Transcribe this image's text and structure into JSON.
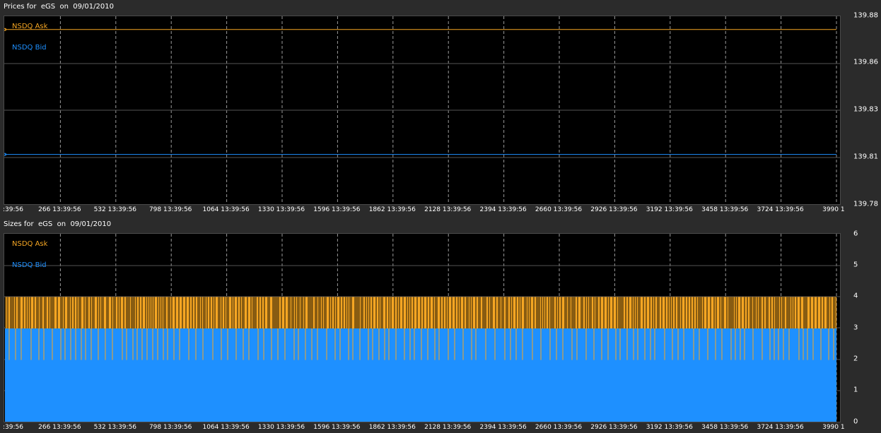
{
  "prices_panel": {
    "title": "Prices for  eGS  on  09/01/2010",
    "legend": [
      {
        "label": "NSDQ Ask",
        "color": "#f5a623"
      },
      {
        "label": "NSDQ Bid",
        "color": "#1e90ff"
      }
    ],
    "y_ticks": [
      "139.88",
      "139.86",
      "139.83",
      "139.81",
      "139.78"
    ]
  },
  "sizes_panel": {
    "title": "Sizes for  eGS  on  09/01/2010",
    "legend": [
      {
        "label": "NSDQ Ask",
        "color": "#f5a623"
      },
      {
        "label": "NSDQ Bid",
        "color": "#1e90ff"
      }
    ],
    "y_ticks": [
      "6",
      "5",
      "4",
      "3",
      "2",
      "1",
      "0"
    ]
  },
  "x_ticks": [
    ":39:56",
    "266 13:39:56",
    "532 13:39:56",
    "798 13:39:56",
    "1064 13:39:56",
    "1330 13:39:56",
    "1596 13:39:56",
    "1862 13:39:56",
    "2128 13:39:56",
    "2394 13:39:56",
    "2660 13:39:56",
    "2926 13:39:56",
    "3192 13:39:56",
    "3458 13:39:56",
    "3724 13:39:56",
    "3990 1"
  ],
  "chart_data": [
    {
      "type": "line",
      "title": "Prices for  eGS  on  09/01/2010",
      "x": [
        0,
        3990
      ],
      "ylim": [
        139.78,
        139.88
      ],
      "grid": true,
      "legend_position": "top-left",
      "series": [
        {
          "name": "NSDQ Ask",
          "color": "#f5a623",
          "values": [
            139.873,
            139.873
          ]
        },
        {
          "name": "NSDQ Bid",
          "color": "#1e90ff",
          "values": [
            139.807,
            139.807
          ]
        }
      ]
    },
    {
      "type": "area",
      "title": "Sizes for  eGS  on  09/01/2010",
      "x": [
        0,
        3990
      ],
      "ylim": [
        0,
        6
      ],
      "grid": true,
      "legend_position": "top-left",
      "series": [
        {
          "name": "NSDQ Ask",
          "color": "#f5a623",
          "values": [
            4,
            4
          ],
          "note_values": "alternates 3-4"
        },
        {
          "name": "NSDQ Bid",
          "color": "#1e90ff",
          "values": [
            3,
            3
          ],
          "note_values": "mostly 3, occasional 2"
        }
      ]
    }
  ]
}
